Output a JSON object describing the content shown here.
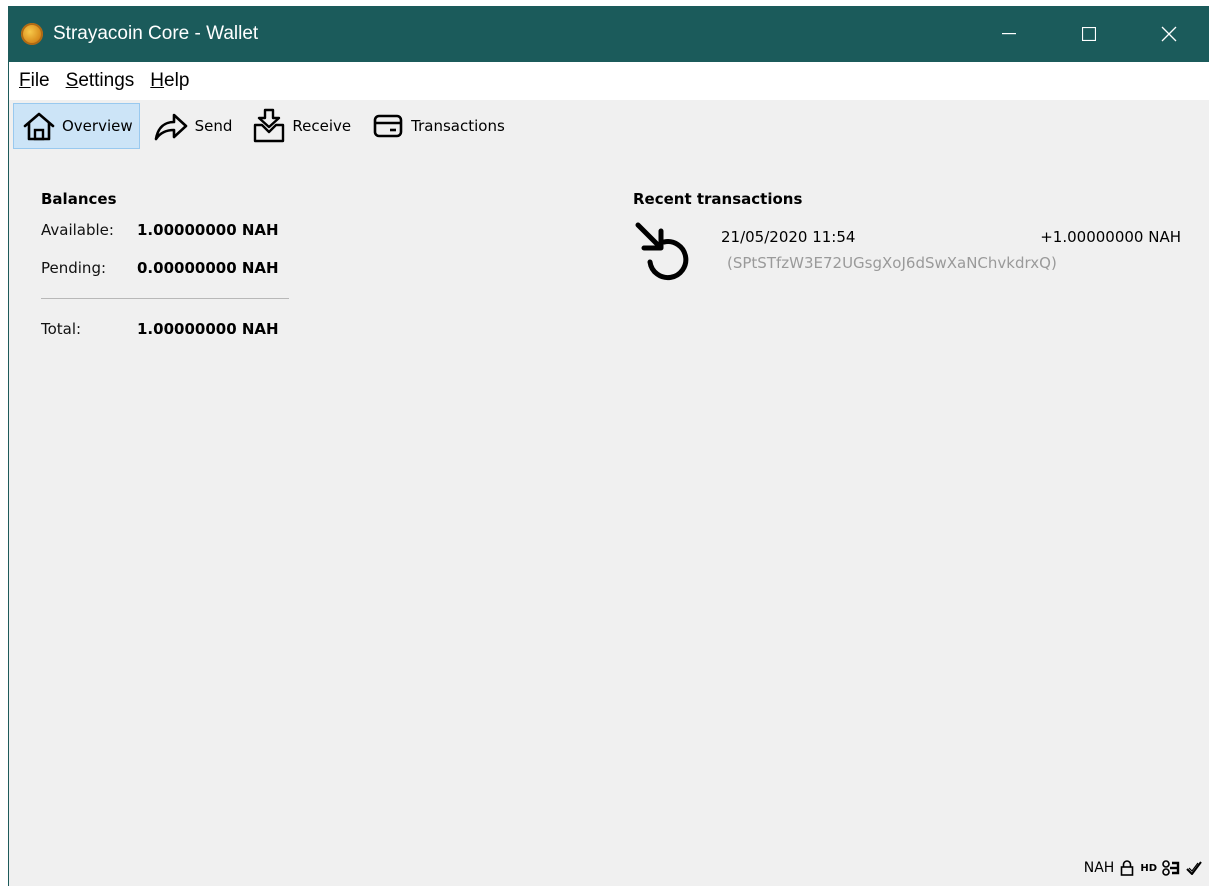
{
  "window": {
    "title": "Strayacoin Core - Wallet",
    "controls": {
      "minimize": "—",
      "maximize": "☐",
      "close": "✕"
    },
    "titlebar_color": "#1b5b5b"
  },
  "menu": {
    "items": [
      {
        "accel": "F",
        "rest": "ile"
      },
      {
        "accel": "S",
        "rest": "ettings"
      },
      {
        "accel": "H",
        "rest": "elp"
      }
    ]
  },
  "toolbar": {
    "overview": {
      "label": "Overview",
      "icon": "home-icon",
      "active": true
    },
    "send": {
      "label": "Send",
      "icon": "send-arrow-icon"
    },
    "receive": {
      "label": "Receive",
      "icon": "receive-inbox-icon"
    },
    "transactions": {
      "label": "Transactions",
      "icon": "card-icon"
    }
  },
  "balances": {
    "title": "Balances",
    "available": {
      "label": "Available:",
      "value": "1.00000000 NAH"
    },
    "pending": {
      "label": "Pending:",
      "value": "0.00000000 NAH"
    },
    "total": {
      "label": "Total:",
      "value": "1.00000000 NAH"
    }
  },
  "recent": {
    "title": "Recent transactions",
    "items": [
      {
        "date": "21/05/2020 11:54",
        "amount": "+1.00000000 NAH",
        "address": "(SPtSTfzW3E72UGsgXoJ6dSwXaNChvkdrxQ)",
        "icon": "received-transaction-icon"
      }
    ]
  },
  "status": {
    "unit": "NAH",
    "hd_label": "HD",
    "icons": [
      "lock-icon",
      "hd-icon",
      "network-icon",
      "synced-check-icon"
    ]
  }
}
